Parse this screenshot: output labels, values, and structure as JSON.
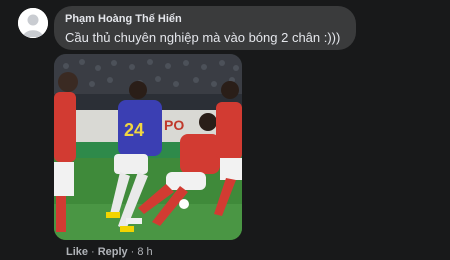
{
  "comment": {
    "author": "Phạm Hoàng Thế Hiển",
    "text": "Cầu thủ chuyên nghiệp mà vào bóng 2 chân :)))",
    "avatar_icon": "default-profile-icon",
    "actions": {
      "like": "Like",
      "reply": "Reply",
      "separator": "·",
      "timestamp": "8 h"
    },
    "media": {
      "sponsor_text": "PO",
      "player_number": "24"
    }
  },
  "colors": {
    "background": "#18191a",
    "bubble": "#3a3b3c",
    "text_primary": "#e4e6eb",
    "text_secondary": "#b0b3b8"
  }
}
